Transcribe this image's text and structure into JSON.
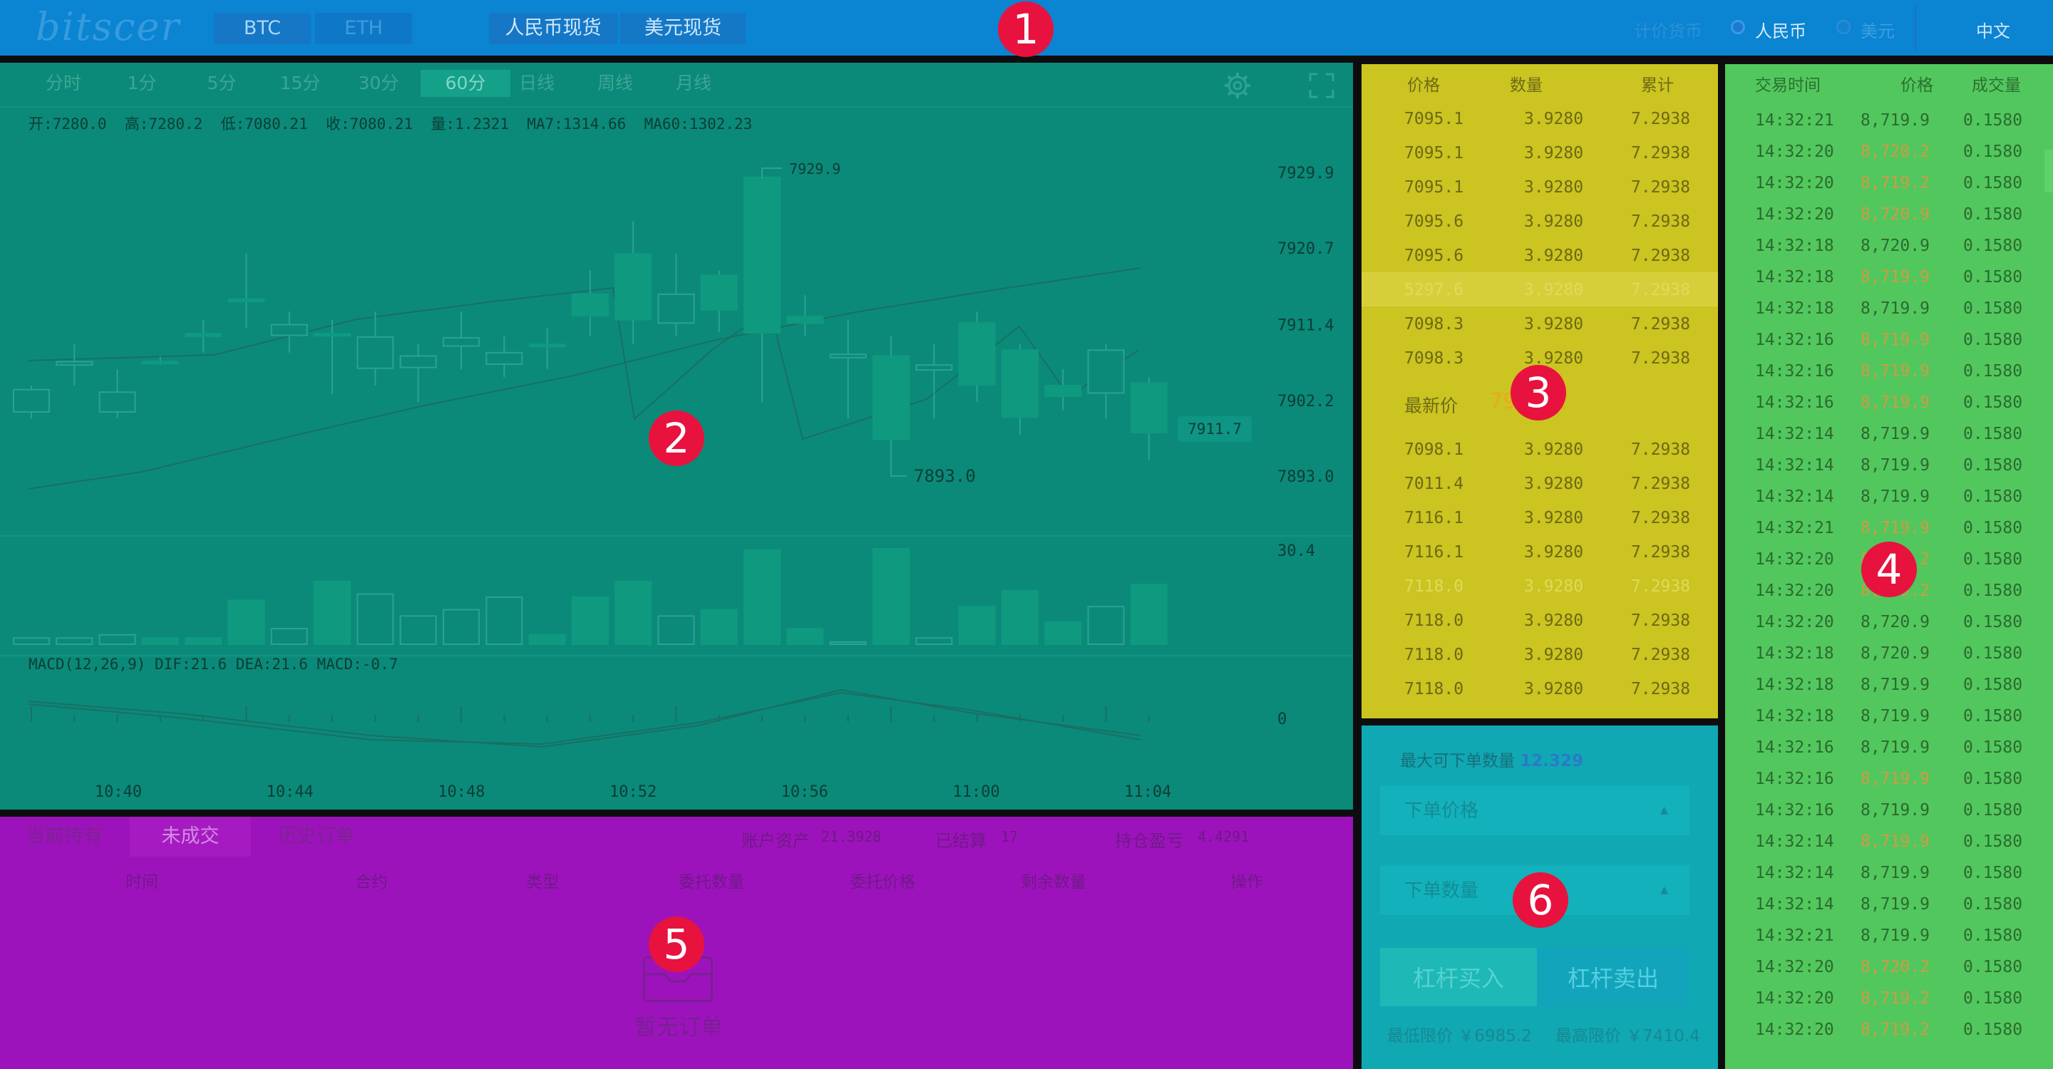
{
  "header": {
    "logo": "bitscer",
    "coins": [
      "BTC",
      "ETH"
    ],
    "markets": [
      "人民币现货",
      "美元现货"
    ],
    "currency_label": "计价货币",
    "currency_options": [
      "人民币",
      "美元"
    ],
    "language": "中文"
  },
  "chart": {
    "timeframes": [
      "分时",
      "1分",
      "5分",
      "15分",
      "30分",
      "60分",
      "日线",
      "周线",
      "月线"
    ],
    "active_timeframe": "60分",
    "ohlc_line": "开:7280.0  高:7280.2  低:7080.21  收:7080.21  量:1.2321  MA7:1314.66  MA60:1302.23",
    "macd_line": "MACD(12,26,9)  DIF:21.6  DEA:21.6  MACD:-0.7",
    "high_marker": "7929.9",
    "low_marker": "7893.0",
    "current_price_tag": "7911.7",
    "y_ticks": [
      "7929.9",
      "7920.7",
      "7911.4",
      "7902.2",
      "7893.0"
    ],
    "volume_max": "30.4",
    "macd_zero": "0",
    "x_ticks": [
      "10:40",
      "10:44",
      "10:48",
      "10:52",
      "10:56",
      "11:00",
      "11:04"
    ]
  },
  "chart_data": {
    "type": "candlestick",
    "x": [
      "10:40",
      "10:41",
      "10:42",
      "10:43",
      "10:44",
      "10:45",
      "10:46",
      "10:47",
      "10:48",
      "10:49",
      "10:50",
      "10:51",
      "10:52",
      "10:53",
      "10:54",
      "10:55",
      "10:56",
      "10:57",
      "10:58",
      "10:59",
      "11:00",
      "11:01",
      "11:02",
      "11:03",
      "11:04",
      "11:05",
      "11:06",
      "11:07"
    ],
    "ylim": [
      7893.0,
      7929.9
    ],
    "series": [
      {
        "name": "kline",
        "candles": [
          {
            "o": 7903.5,
            "c": 7900.8,
            "h": 7904.0,
            "l": 7900.0
          },
          {
            "o": 7906.9,
            "c": 7906.5,
            "h": 7909.0,
            "l": 7904.0
          },
          {
            "o": 7903.2,
            "c": 7900.8,
            "h": 7906.0,
            "l": 7900.0
          },
          {
            "o": 7906.8,
            "c": 7906.9,
            "h": 7907.5,
            "l": 7906.5
          },
          {
            "o": 7910.0,
            "c": 7910.3,
            "h": 7912.0,
            "l": 7908.0
          },
          {
            "o": 7914.2,
            "c": 7914.5,
            "h": 7920.0,
            "l": 7911.0
          },
          {
            "o": 7911.4,
            "c": 7910.1,
            "h": 7913.0,
            "l": 7908.0
          },
          {
            "o": 7910.1,
            "c": 7910.3,
            "h": 7912.0,
            "l": 7903.0
          },
          {
            "o": 7909.9,
            "c": 7906.1,
            "h": 7913.0,
            "l": 7904.0
          },
          {
            "o": 7907.6,
            "c": 7906.2,
            "h": 7909.0,
            "l": 7902.0
          },
          {
            "o": 7909.8,
            "c": 7908.8,
            "h": 7913.0,
            "l": 7906.0
          },
          {
            "o": 7908.0,
            "c": 7906.6,
            "h": 7910.0,
            "l": 7905.0
          },
          {
            "o": 7909.0,
            "c": 7909.0,
            "h": 7911.0,
            "l": 7906.0
          },
          {
            "o": 7912.5,
            "c": 7915.1,
            "h": 7918.0,
            "l": 7910.0
          },
          {
            "o": 7912.0,
            "c": 7920.0,
            "h": 7924.0,
            "l": 7909.0
          },
          {
            "o": 7915.1,
            "c": 7911.6,
            "h": 7920.0,
            "l": 7910.0
          },
          {
            "o": 7913.2,
            "c": 7917.4,
            "h": 7918.0,
            "l": 7910.5
          },
          {
            "o": 7910.4,
            "c": 7929.3,
            "h": 7929.9,
            "l": 7902.0
          },
          {
            "o": 7911.6,
            "c": 7912.4,
            "h": 7915.0,
            "l": 7910.0
          },
          {
            "o": 7907.8,
            "c": 7907.4,
            "h": 7912.0,
            "l": 7900.0
          },
          {
            "o": 7897.5,
            "c": 7907.6,
            "h": 7910.0,
            "l": 7893.0
          },
          {
            "o": 7906.5,
            "c": 7905.9,
            "h": 7909.0,
            "l": 7900.0
          },
          {
            "o": 7904.1,
            "c": 7911.6,
            "h": 7913.0,
            "l": 7902.0
          },
          {
            "o": 7900.2,
            "c": 7908.3,
            "h": 7909.0,
            "l": 7898.0
          },
          {
            "o": 7902.7,
            "c": 7904.0,
            "h": 7906.0,
            "l": 7901.0
          },
          {
            "o": 7908.3,
            "c": 7903.1,
            "h": 7909.0,
            "l": 7900.0
          },
          {
            "o": 7898.3,
            "c": 7904.3,
            "h": 7905.0,
            "l": 7895.0
          }
        ]
      }
    ],
    "volume": [
      2,
      2,
      3,
      2,
      2,
      14,
      5,
      20,
      16,
      9,
      11,
      15,
      3,
      15,
      20,
      9,
      11,
      30,
      5,
      0,
      30.4,
      2,
      12,
      17,
      7,
      12,
      19
    ],
    "grid": true
  },
  "orderbook": {
    "headers": [
      "价格",
      "数量",
      "累计"
    ],
    "asks": [
      [
        "7095.1",
        "3.9280",
        "7.2938"
      ],
      [
        "7095.1",
        "3.9280",
        "7.2938"
      ],
      [
        "7095.1",
        "3.9280",
        "7.2938"
      ],
      [
        "7095.6",
        "3.9280",
        "7.2938"
      ],
      [
        "7095.6",
        "3.9280",
        "7.2938"
      ],
      [
        "5297.6",
        "3.9280",
        "7.2938"
      ],
      [
        "7098.3",
        "3.9280",
        "7.2938"
      ],
      [
        "7098.3",
        "3.9280",
        "7.2938"
      ]
    ],
    "last_label": "最新价",
    "last_price": "7911.1",
    "bids": [
      [
        "7098.1",
        "3.9280",
        "7.2938"
      ],
      [
        "7011.4",
        "3.9280",
        "7.2938"
      ],
      [
        "7116.1",
        "3.9280",
        "7.2938"
      ],
      [
        "7116.1",
        "3.9280",
        "7.2938"
      ],
      [
        "7118.0",
        "3.9280",
        "7.2938"
      ],
      [
        "7118.0",
        "3.9280",
        "7.2938"
      ],
      [
        "7118.0",
        "3.9280",
        "7.2938"
      ],
      [
        "7118.0",
        "3.9280",
        "7.2938"
      ]
    ]
  },
  "trade_form": {
    "max_label": "最大可下单数量",
    "max_value": "12.329",
    "price_placeholder": "下单价格",
    "amount_placeholder": "下单数量",
    "buy_label": "杠杆买入",
    "sell_label": "杠杆卖出",
    "min_limit": "最低限价 ￥6985.2",
    "max_limit": "最高限价 ￥7410.4"
  },
  "trades": {
    "headers": [
      "交易时间",
      "价格",
      "成交量"
    ],
    "rows": [
      [
        "14:32:21",
        "8,719.9",
        "0.1580"
      ],
      [
        "14:32:20",
        "8,720.2",
        "0.1580"
      ],
      [
        "14:32:20",
        "8,719.2",
        "0.1580"
      ],
      [
        "14:32:20",
        "8,720.9",
        "0.1580"
      ],
      [
        "14:32:18",
        "8,720.9",
        "0.1580"
      ],
      [
        "14:32:18",
        "8,719.9",
        "0.1580"
      ],
      [
        "14:32:18",
        "8,719.9",
        "0.1580"
      ],
      [
        "14:32:16",
        "8,719.9",
        "0.1580"
      ],
      [
        "14:32:16",
        "8,719.9",
        "0.1580"
      ],
      [
        "14:32:16",
        "8,719.9",
        "0.1580"
      ],
      [
        "14:32:14",
        "8,719.9",
        "0.1580"
      ],
      [
        "14:32:14",
        "8,719.9",
        "0.1580"
      ],
      [
        "14:32:14",
        "8,719.9",
        "0.1580"
      ],
      [
        "14:32:21",
        "8,719.9",
        "0.1580"
      ],
      [
        "14:32:20",
        "8,720.2",
        "0.1580"
      ],
      [
        "14:32:20",
        "8,719.2",
        "0.1580"
      ],
      [
        "14:32:20",
        "8,720.9",
        "0.1580"
      ],
      [
        "14:32:18",
        "8,720.9",
        "0.1580"
      ],
      [
        "14:32:18",
        "8,719.9",
        "0.1580"
      ],
      [
        "14:32:18",
        "8,719.9",
        "0.1580"
      ],
      [
        "14:32:16",
        "8,719.9",
        "0.1580"
      ],
      [
        "14:32:16",
        "8,719.9",
        "0.1580"
      ],
      [
        "14:32:16",
        "8,719.9",
        "0.1580"
      ],
      [
        "14:32:14",
        "8,719.9",
        "0.1580"
      ],
      [
        "14:32:14",
        "8,719.9",
        "0.1580"
      ],
      [
        "14:32:14",
        "8,719.9",
        "0.1580"
      ],
      [
        "14:32:21",
        "8,719.9",
        "0.1580"
      ],
      [
        "14:32:20",
        "8,720.2",
        "0.1580"
      ],
      [
        "14:32:20",
        "8,719.2",
        "0.1580"
      ],
      [
        "14:32:20",
        "8,719.2",
        "0.1580"
      ]
    ],
    "price_colors": [
      "green",
      "red",
      "red",
      "red",
      "green",
      "red",
      "green",
      "red",
      "red",
      "red",
      "green",
      "green",
      "green",
      "red",
      "red",
      "red",
      "green",
      "green",
      "green",
      "green",
      "green",
      "red",
      "green",
      "red",
      "green",
      "green",
      "green",
      "red",
      "red",
      "red"
    ]
  },
  "orders": {
    "tabs": [
      "当前持有",
      "未成交",
      "历史订单"
    ],
    "active_tab": "未成交",
    "stats": [
      {
        "label": "账户资产",
        "value": "21.3928"
      },
      {
        "label": "已结算",
        "value": "17"
      },
      {
        "label": "持仓盈亏",
        "value": "4.4291"
      }
    ],
    "columns": [
      "时间",
      "合约",
      "类型",
      "委托数量",
      "委托价格",
      "剩余数量",
      "操作"
    ],
    "empty_label": "暂无订单"
  },
  "markers": [
    "1",
    "2",
    "3",
    "4",
    "5",
    "6"
  ]
}
